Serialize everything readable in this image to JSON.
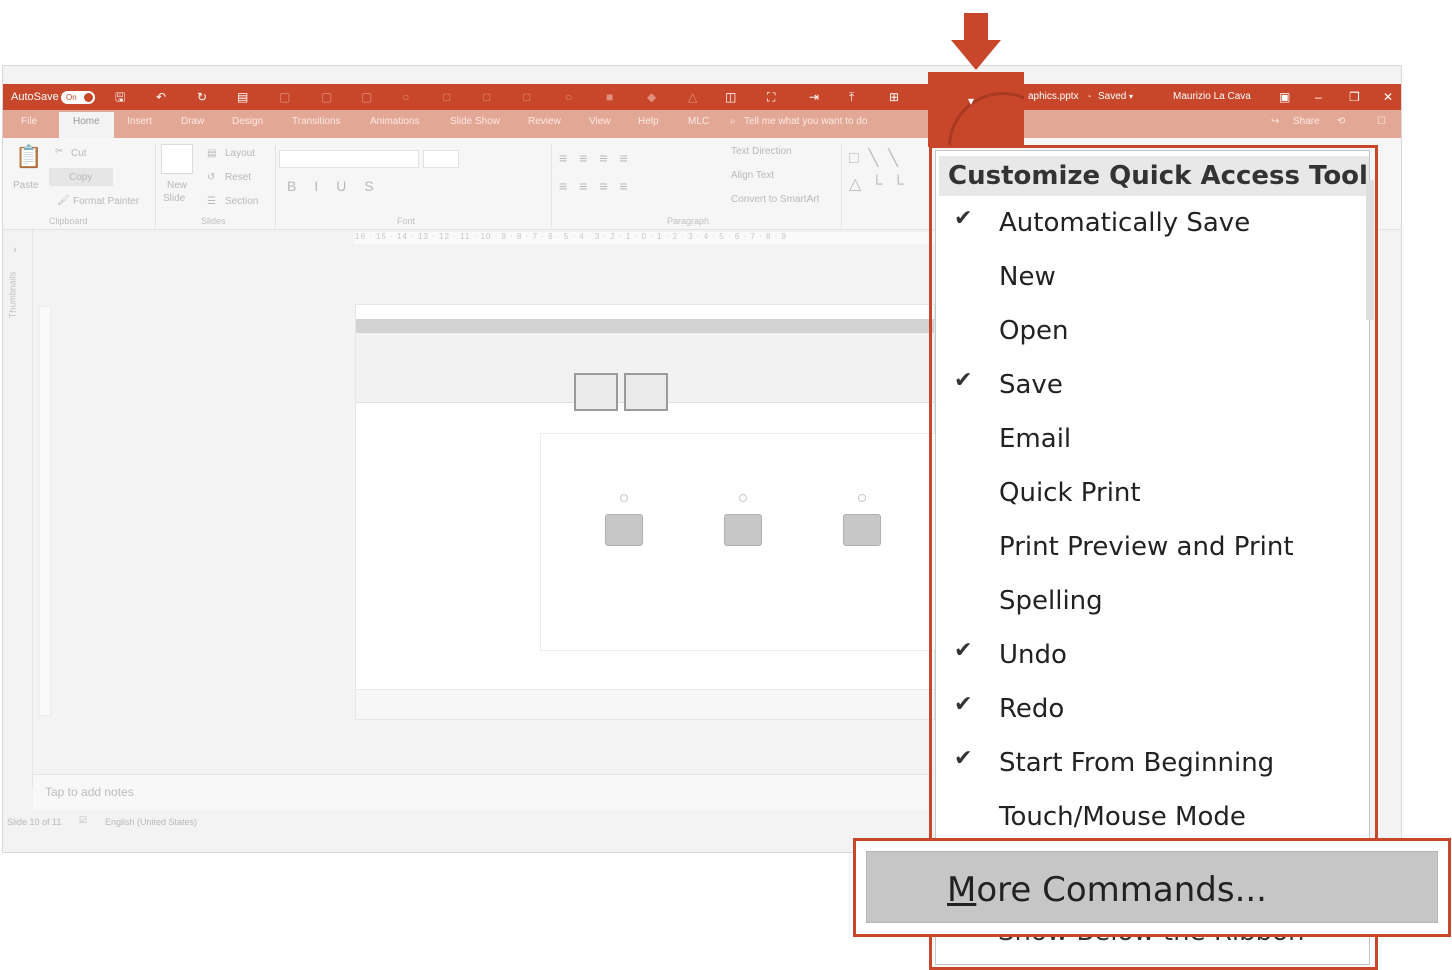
{
  "window": {
    "title_file": "aphics.pptx",
    "title_sep": "-",
    "saved_status": "Saved",
    "user_name": "Maurizio La Cava",
    "autosave_label": "AutoSave",
    "autosave_state": "On",
    "share_label": "Share",
    "accent_color": "#c8472a"
  },
  "tabs": [
    "File",
    "Home",
    "Insert",
    "Draw",
    "Design",
    "Transitions",
    "Animations",
    "Slide Show",
    "Review",
    "View",
    "Help",
    "MLC"
  ],
  "active_tab": "Home",
  "tell_me": "Tell me what you want to do",
  "ribbon": {
    "clipboard": {
      "paste": "Paste",
      "cut": "Cut",
      "copy": "Copy",
      "format_painter": "Format Painter",
      "group": "Clipboard"
    },
    "slides": {
      "new_slide_line1": "New",
      "new_slide_line2": "Slide",
      "layout": "Layout",
      "reset": "Reset",
      "section": "Section",
      "group": "Slides"
    },
    "font": {
      "group": "Font"
    },
    "paragraph": {
      "text_direction": "Text Direction",
      "align_text": "Align Text",
      "convert_smartart": "Convert to SmartArt",
      "group": "Paragraph"
    }
  },
  "ruler_text": "16 · 15 · 14 · 13 · 12 · 11 · 10 · 9 · 8 · 7 · 6 · 5 · 4 · 3 · 2 · 1 · 0 · 1 · 2 · 3 · 4 · 5 · 6 · 7 · 8 · 9",
  "left_pane_label": "Thumbnails",
  "notes_placeholder": "Tap to add notes",
  "status": {
    "slide": "Slide 10 of 11",
    "language": "English (United States)"
  },
  "menu": {
    "header": "Customize Quick Access Toolbar",
    "items": [
      {
        "label": "Automatically Save",
        "checked": true
      },
      {
        "label": "New",
        "checked": false
      },
      {
        "label": "Open",
        "checked": false
      },
      {
        "label": "Save",
        "checked": true
      },
      {
        "label": "Email",
        "checked": false
      },
      {
        "label": "Quick Print",
        "checked": false
      },
      {
        "label": "Print Preview and Print",
        "checked": false
      },
      {
        "label": "Spelling",
        "checked": false
      },
      {
        "label": "Undo",
        "checked": true
      },
      {
        "label": "Redo",
        "checked": true
      },
      {
        "label": "Start From Beginning",
        "checked": true
      },
      {
        "label": "Touch/Mouse Mode",
        "checked": false
      }
    ],
    "check_glyph": "✔",
    "more_commands_mnemonic": "M",
    "more_commands_rest": "ore Commands...",
    "show_below_ribbon": "Show Below the Ribbon"
  }
}
